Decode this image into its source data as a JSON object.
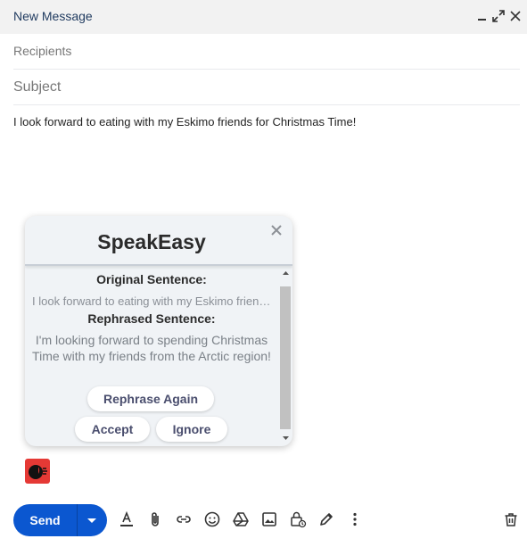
{
  "window": {
    "title": "New Message"
  },
  "icons": {
    "minimize": "minimize-icon",
    "expand": "expand-icon",
    "close": "close-icon"
  },
  "compose": {
    "recipients_placeholder": "Recipients",
    "subject_placeholder": "Subject",
    "body": "I look forward to eating with my Eskimo friends for Christmas Time!"
  },
  "speakeasy": {
    "title": "SpeakEasy",
    "original_label": "Original Sentence:",
    "original_text": "I look forward to eating with my Eskimo friends for Christmas Time!",
    "rephrased_label": "Rephrased Sentence:",
    "rephrased_text": "I'm looking forward to spending Christmas Time with my friends from the Arctic region!",
    "buttons": {
      "rephrase_again": "Rephrase Again",
      "accept": "Accept",
      "ignore": "Ignore"
    }
  },
  "toolbar": {
    "send_label": "Send",
    "tools": [
      "format-text-icon",
      "attach-icon",
      "link-icon",
      "emoji-icon",
      "drive-icon",
      "photo-icon",
      "confidential-icon",
      "signature-icon",
      "more-options-icon",
      "trash-icon"
    ]
  },
  "colors": {
    "send_blue": "#0b57d0",
    "popup_bg": "#f0f3f6",
    "logo_red": "#e53935"
  }
}
